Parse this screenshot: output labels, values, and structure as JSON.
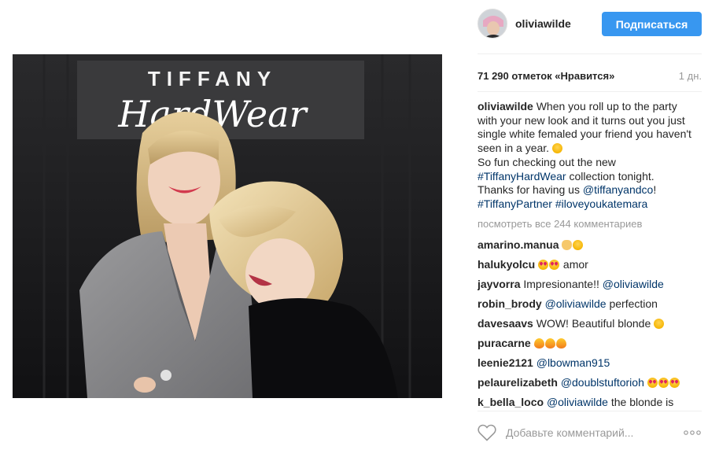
{
  "post": {
    "image_sign": {
      "line1": "TIFFANY",
      "line2": "HardWear"
    }
  },
  "header": {
    "username": "oliviawilde",
    "follow_label": "Подписаться"
  },
  "stats": {
    "likes": "71 290 отметок «Нравится»",
    "time": "1 дн."
  },
  "caption": {
    "username": "oliviawilde",
    "text1": "When you roll up to the party with your new look and it turns out you just single white femaled your friend you haven't seen in a year.",
    "text2": "So fun checking out the new",
    "tag1": "#TiffanyHardWear",
    "text3": "collection tonight. Thanks for having us",
    "mention": "@tiffanyandco",
    "text4": "!",
    "tag2": "#TiffanyPartner",
    "tag3": "#iloveyoukatemara"
  },
  "view_all": "посмотреть все 244 комментариев",
  "comments": [
    {
      "user": "amarino.manua",
      "text": ""
    },
    {
      "user": "halukyolcu",
      "text": "amor"
    },
    {
      "user": "jayvorra",
      "text": "Impresionante!!",
      "mention": "@oliviawilde"
    },
    {
      "user": "robin_brody",
      "mention": "@oliviawilde",
      "text": "perfection"
    },
    {
      "user": "davesaavs",
      "text": "WOW! Beautiful blonde"
    },
    {
      "user": "puracarne",
      "text": ""
    },
    {
      "user": "leenie2121",
      "mention": "@lbowman915"
    },
    {
      "user": "pelaurelizabeth",
      "mention": "@doublstuftorioh"
    },
    {
      "user": "k_bella_loco",
      "mention": "@oliviawilde",
      "text": "the blonde is"
    }
  ],
  "comment_box": {
    "placeholder": "Добавьте комментарий..."
  },
  "icons": {
    "like": "heart-icon",
    "options": "more-options-icon"
  },
  "colors": {
    "accent": "#3897f0",
    "link": "#003569",
    "muted": "#999999"
  }
}
